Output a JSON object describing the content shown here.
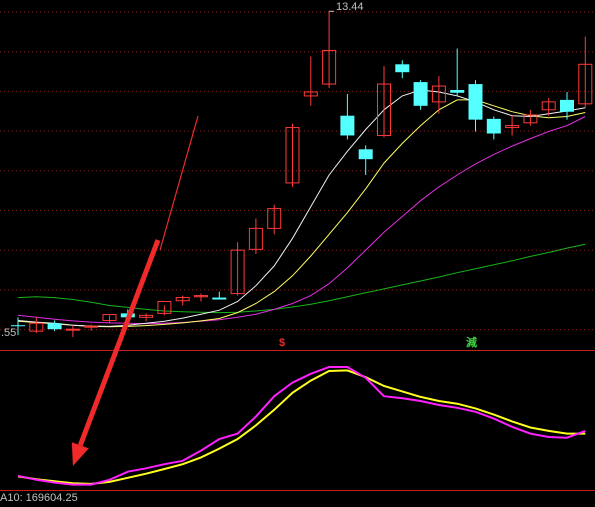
{
  "chart_data": {
    "type": "candlestick",
    "high_label": "13.44",
    "low_label": ".55",
    "indicator_label": "A10: 169604.25",
    "signals": [
      {
        "text": "$",
        "color": "#e03030",
        "candle": 13
      },
      {
        "text": "減",
        "color": "#40d040",
        "candle": 22
      }
    ],
    "colors": {
      "background": "#000000",
      "grid": "#8a1f1f",
      "panel_divider": "#c81e1e",
      "up_candle": "#ff3a3a",
      "down_candle": "#54ffff",
      "ma_short": "#f0f0f0",
      "ma_mid": "#ffff64",
      "ma_long": "#e030e0",
      "ma_longest": "#19b419",
      "osc_fast": "#ff20ff",
      "osc_slow": "#ffff20",
      "arrow": "#f02a2a"
    },
    "candles": [
      {
        "o": 5.5,
        "h": 5.7,
        "l": 5.25,
        "c": 5.48
      },
      {
        "o": 5.35,
        "h": 5.7,
        "l": 5.3,
        "c": 5.55
      },
      {
        "o": 5.55,
        "h": 5.62,
        "l": 5.35,
        "c": 5.4
      },
      {
        "o": 5.4,
        "h": 5.5,
        "l": 5.2,
        "c": 5.4
      },
      {
        "o": 5.45,
        "h": 5.52,
        "l": 5.36,
        "c": 5.48
      },
      {
        "o": 5.62,
        "h": 5.75,
        "l": 5.55,
        "c": 5.77
      },
      {
        "o": 5.8,
        "h": 5.9,
        "l": 5.72,
        "c": 5.7
      },
      {
        "o": 5.7,
        "h": 5.8,
        "l": 5.6,
        "c": 5.75
      },
      {
        "o": 5.8,
        "h": 6.0,
        "l": 5.75,
        "c": 6.1
      },
      {
        "o": 6.12,
        "h": 6.25,
        "l": 6.0,
        "c": 6.2
      },
      {
        "o": 6.22,
        "h": 6.3,
        "l": 6.1,
        "c": 6.25
      },
      {
        "o": 6.2,
        "h": 6.35,
        "l": 6.15,
        "c": 6.15
      },
      {
        "o": 6.3,
        "h": 7.6,
        "l": 6.25,
        "c": 7.4
      },
      {
        "o": 7.42,
        "h": 8.2,
        "l": 7.3,
        "c": 7.95
      },
      {
        "o": 7.95,
        "h": 8.55,
        "l": 7.8,
        "c": 8.45
      },
      {
        "o": 9.1,
        "h": 10.6,
        "l": 9.0,
        "c": 10.5
      },
      {
        "o": 11.3,
        "h": 12.3,
        "l": 11.05,
        "c": 11.4
      },
      {
        "o": 11.6,
        "h": 13.44,
        "l": 11.5,
        "c": 12.45
      },
      {
        "o": 10.8,
        "h": 11.35,
        "l": 10.2,
        "c": 10.3
      },
      {
        "o": 9.95,
        "h": 10.05,
        "l": 9.3,
        "c": 9.7
      },
      {
        "o": 10.3,
        "h": 12.05,
        "l": 10.25,
        "c": 11.6
      },
      {
        "o": 12.1,
        "h": 12.2,
        "l": 11.75,
        "c": 11.9
      },
      {
        "o": 11.65,
        "h": 11.7,
        "l": 10.95,
        "c": 11.05
      },
      {
        "o": 11.15,
        "h": 11.8,
        "l": 10.85,
        "c": 11.55
      },
      {
        "o": 11.45,
        "h": 12.5,
        "l": 11.3,
        "c": 11.38
      },
      {
        "o": 11.6,
        "h": 11.7,
        "l": 10.4,
        "c": 10.7
      },
      {
        "o": 10.72,
        "h": 10.78,
        "l": 10.2,
        "c": 10.35
      },
      {
        "o": 10.5,
        "h": 10.8,
        "l": 10.3,
        "c": 10.55
      },
      {
        "o": 10.62,
        "h": 10.95,
        "l": 10.55,
        "c": 10.82
      },
      {
        "o": 10.95,
        "h": 11.25,
        "l": 10.8,
        "c": 11.15
      },
      {
        "o": 11.2,
        "h": 11.4,
        "l": 10.7,
        "c": 10.9
      },
      {
        "o": 11.1,
        "h": 12.8,
        "l": 11.0,
        "c": 12.1
      }
    ],
    "ma_short": [
      5.62,
      5.58,
      5.55,
      5.5,
      5.48,
      5.47,
      5.5,
      5.55,
      5.6,
      5.68,
      5.78,
      5.88,
      6.1,
      6.5,
      7.0,
      7.7,
      8.5,
      9.3,
      9.9,
      10.45,
      10.95,
      11.3,
      11.45,
      11.4,
      11.3,
      11.15,
      10.95,
      10.8,
      10.78,
      10.85,
      10.92,
      11.0
    ],
    "ma_mid": [
      5.6,
      5.57,
      5.54,
      5.5,
      5.47,
      5.46,
      5.47,
      5.49,
      5.52,
      5.56,
      5.61,
      5.67,
      5.82,
      6.05,
      6.35,
      6.75,
      7.25,
      7.8,
      8.35,
      8.95,
      9.6,
      10.1,
      10.55,
      10.95,
      11.2,
      11.2,
      11.05,
      10.9,
      10.8,
      10.75,
      10.78,
      10.88
    ],
    "ma_long": [
      5.75,
      5.7,
      5.65,
      5.61,
      5.58,
      5.56,
      5.55,
      5.54,
      5.55,
      5.57,
      5.6,
      5.64,
      5.7,
      5.78,
      5.9,
      6.05,
      6.25,
      6.55,
      6.95,
      7.4,
      7.85,
      8.25,
      8.65,
      9.0,
      9.3,
      9.58,
      9.82,
      10.03,
      10.22,
      10.4,
      10.55,
      10.78
    ],
    "ma_longest": [
      6.2,
      6.22,
      6.2,
      6.15,
      6.08,
      6.0,
      5.95,
      5.9,
      5.86,
      5.84,
      5.83,
      5.82,
      5.83,
      5.86,
      5.9,
      5.96,
      6.03,
      6.12,
      6.22,
      6.32,
      6.42,
      6.52,
      6.62,
      6.72,
      6.83,
      6.93,
      7.03,
      7.13,
      7.24,
      7.34,
      7.45,
      7.55
    ],
    "osc_fast": [
      0.18,
      0.12,
      0.08,
      0.05,
      0.05,
      0.12,
      0.24,
      0.29,
      0.35,
      0.4,
      0.55,
      0.72,
      0.8,
      1.05,
      1.35,
      1.55,
      1.68,
      1.78,
      1.78,
      1.62,
      1.35,
      1.32,
      1.28,
      1.22,
      1.18,
      1.12,
      1.02,
      0.9,
      0.8,
      0.75,
      0.74,
      0.84
    ],
    "osc_slow": [
      0.17,
      0.13,
      0.1,
      0.07,
      0.06,
      0.09,
      0.15,
      0.21,
      0.28,
      0.35,
      0.45,
      0.58,
      0.72,
      0.92,
      1.15,
      1.4,
      1.58,
      1.72,
      1.73,
      1.63,
      1.5,
      1.42,
      1.34,
      1.28,
      1.24,
      1.17,
      1.08,
      0.98,
      0.89,
      0.84,
      0.8,
      0.8
    ],
    "price_range": [
      5.0,
      13.6
    ],
    "osc_range": [
      0.0,
      2.0
    ],
    "arrow_target_candle": 3,
    "grid": true
  }
}
